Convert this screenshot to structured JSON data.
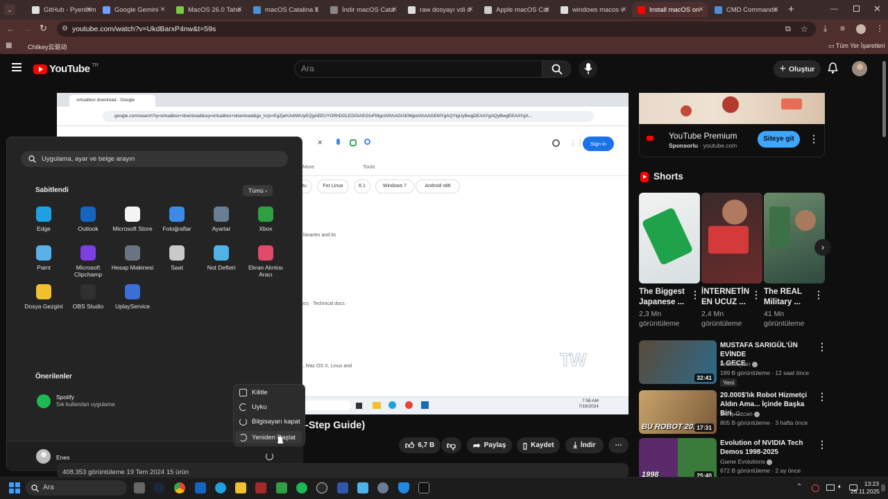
{
  "tabs": [
    {
      "label": "GitHub - Pyenb/m",
      "color": "#e0e0e0"
    },
    {
      "label": "Google Gemini",
      "color": "#6aa0ff"
    },
    {
      "label": "MacOS 26.0 Taho",
      "color": "#7ac943"
    },
    {
      "label": "macOS Catalina 1",
      "color": "#4a90d9"
    },
    {
      "label": "İndir macOS Cata",
      "color": "#888888"
    },
    {
      "label": "raw dosyayı vdi d",
      "color": "#dddddd"
    },
    {
      "label": "Apple macOS Cat",
      "color": "#cccccc"
    },
    {
      "label": "windows macos v",
      "color": "#dddddd"
    },
    {
      "label": "Install macOS on",
      "color": "#ff0000"
    },
    {
      "label": "CMD Commands",
      "color": "#4a90d9"
    }
  ],
  "address": {
    "url": "youtube.com/watch?v=UkdBarxP4nw&t=59s"
  },
  "bookmarks": {
    "left": "Chilkey云驱动",
    "right": "Tüm Yer İşaretleri"
  },
  "youtube": {
    "logo": "YouTube",
    "logo_sup": "TR",
    "search_placeholder": "Ara",
    "create_label": "Oluştur"
  },
  "video_frame": {
    "tab_label": "virtualbox download - Google",
    "url": "google.com/search?q=virtualbox+download&oq=virtualbox+download&gs_lcrp=EgZjaHJvbWUyEQgAEEUYORhDGLEDGIAEGIoFMgcIARAAGIAEMgwIAhAAGEMYgAQYigUyBwgDEAAYgAQyBwgEEAAYgA...",
    "signin": "Sign in",
    "tools_more": "More",
    "tools_tools": "Tools",
    "chips": [
      "ıntu",
      "For Linux",
      "6.1",
      "Windows 7",
      "Android x86"
    ],
    "frag1": "binaries and its",
    "frag2": "ocs · Technical docs ·",
    "frag3": ", Mac OS X, Linux and",
    "time": "7:56 AM",
    "date": "7/19/2024",
    "watermark": "TW"
  },
  "start_menu": {
    "search_placeholder": "Uygulama, ayar ve belge arayın",
    "pinned_title": "Sabitlendi",
    "all_button": "Tümü",
    "apps": [
      {
        "label": "Edge",
        "color": "#1fa0e0"
      },
      {
        "label": "Outlook",
        "color": "#1565c0"
      },
      {
        "label": "Microsoft Store",
        "color": "#f4f4f4"
      },
      {
        "label": "Fotoğraflar",
        "color": "#3d8be8"
      },
      {
        "label": "Ayarlar",
        "color": "#6a7d94"
      },
      {
        "label": "Xbox",
        "color": "#2ea043"
      },
      {
        "label": "Paint",
        "color": "#5ab0e8"
      },
      {
        "label": "Microsoft Clipchamp",
        "color": "#7b3fe4"
      },
      {
        "label": "Hesap Makinesi",
        "color": "#6a7480"
      },
      {
        "label": "Saat",
        "color": "#c9c9c9"
      },
      {
        "label": "Not Defteri",
        "color": "#4fb3e8"
      },
      {
        "label": "Ekran Alıntısı Aracı",
        "color": "#e24a6b"
      },
      {
        "label": "Dosya Gezgini",
        "color": "#f0c030"
      },
      {
        "label": "OBS Studio",
        "color": "#303030"
      },
      {
        "label": "UplayService",
        "color": "#3b6fd6"
      }
    ],
    "recommended_title": "Önerilenler",
    "rec_name": "Spotify",
    "rec_sub": "Sık kullanılan uygulama",
    "user": "Enes",
    "power": [
      "Kilitle",
      "Uyku",
      "Bilgisayarı kapat",
      "Yeniden Başlat"
    ]
  },
  "below_video": {
    "title_fragment": "-Step Guide)",
    "likes": "6,7 B",
    "share": "Paylaş",
    "save": "Kaydet",
    "download": "İndir",
    "views_fragment": "408.353 görüntüleme  19 Tem 2024  15 ürün"
  },
  "ad": {
    "title": "YouTube Premium",
    "sponsor": "Sponsorlu",
    "domain": "· youtube.com",
    "button": "Siteye git"
  },
  "shorts": {
    "title": "Shorts",
    "items": [
      {
        "title1": "The Biggest",
        "title2": "Japanese ...",
        "views1": "2,3 Mn",
        "views2": "görüntüleme"
      },
      {
        "title1": "İNTERNETİN",
        "title2": "EN UCUZ ...",
        "views1": "2,4 Mn",
        "views2": "görüntüleme"
      },
      {
        "title1": "The REAL",
        "title2": "Military ...",
        "views1": "41 Mn",
        "views2": "görüntüleme"
      }
    ]
  },
  "related": [
    {
      "title1": "MUSTAFA SARIGÜL'ÜN EVİNDE",
      "title2": "1 GECE",
      "channel": "testo taylan",
      "meta": "189 B görüntüleme · 12 saat önce",
      "badge": "Yeni",
      "duration": "32:41"
    },
    {
      "title1": "20.000$'lık Robot Hizmetçi",
      "title2": "Aldın Ama... İçinde Başka Biri ...",
      "channel": "Barış Özcan",
      "meta": "805 B görüntüleme · 3 hafta önce",
      "badge": "",
      "duration": "17:31",
      "thumb_text": "BU ROBOT 20.000"
    },
    {
      "title1": "Evolution of NVIDIA Tech",
      "title2": "Demos 1998-2025",
      "channel": "Game Evolutions",
      "meta": "672 B görüntüleme · 2 ay önce",
      "badge": "",
      "duration": "25:40",
      "thumb_text": "1998"
    }
  ],
  "taskbar": {
    "search": "Ara",
    "time": "13:23",
    "date": "26.11.2025"
  }
}
